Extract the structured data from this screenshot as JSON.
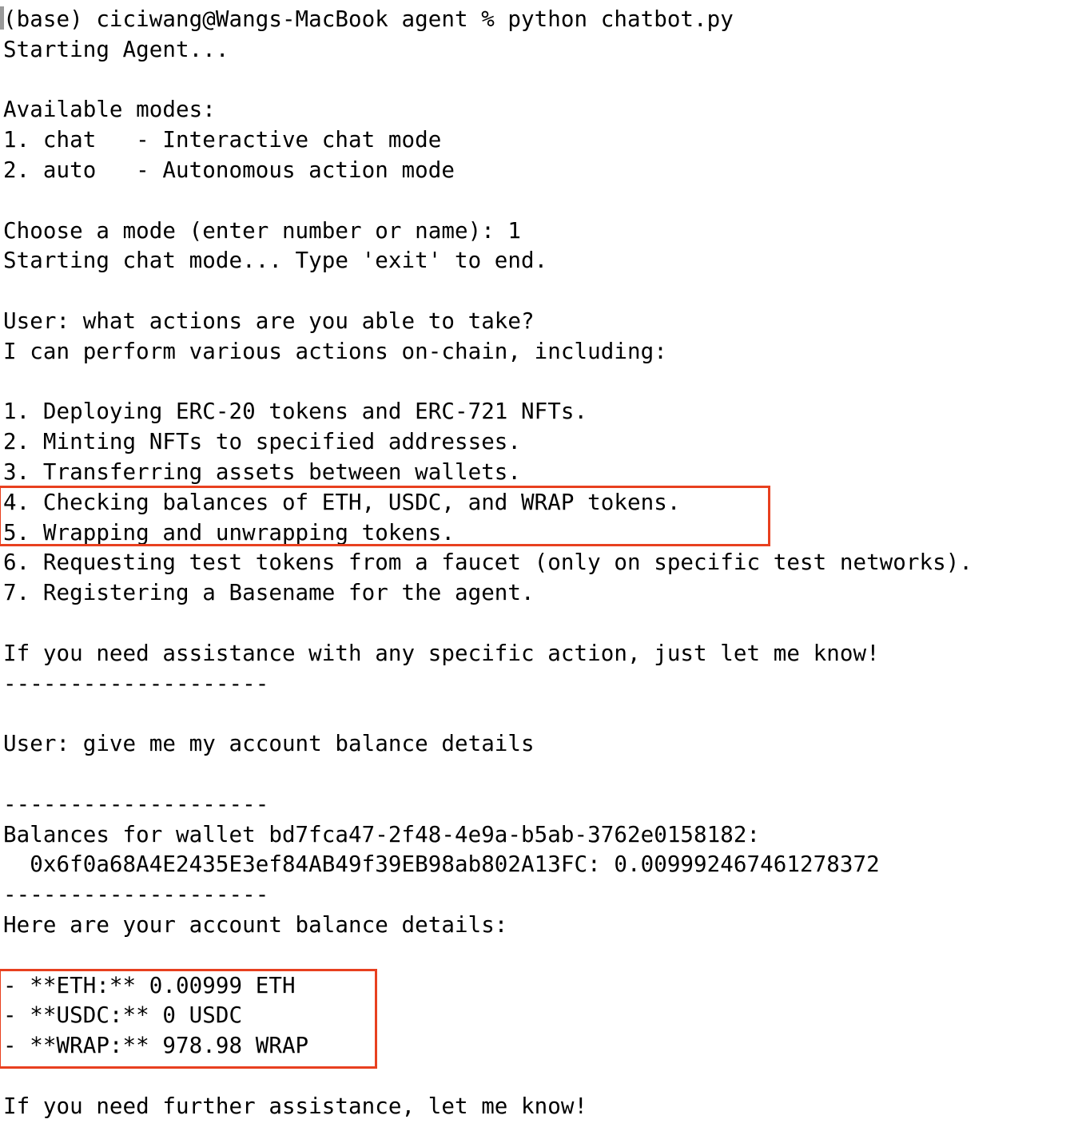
{
  "terminal": {
    "cursor_glyph": "block-cursor",
    "prompt": "(base) ciciwang@Wangs-MacBook agent % python chatbot.py",
    "lines": [
      "(base) ciciwang@Wangs-MacBook agent % python chatbot.py",
      "Starting Agent...",
      "",
      "Available modes:",
      "1. chat   - Interactive chat mode",
      "2. auto   - Autonomous action mode",
      "",
      "Choose a mode (enter number or name): 1",
      "Starting chat mode... Type 'exit' to end.",
      "",
      "User: what actions are you able to take?",
      "I can perform various actions on-chain, including:",
      "",
      "1. Deploying ERC-20 tokens and ERC-721 NFTs.",
      "2. Minting NFTs to specified addresses.",
      "3. Transferring assets between wallets.",
      "4. Checking balances of ETH, USDC, and WRAP tokens.",
      "5. Wrapping and unwrapping tokens.",
      "6. Requesting test tokens from a faucet (only on specific test networks).",
      "7. Registering a Basename for the agent.",
      "",
      "If you need assistance with any specific action, just let me know!",
      "--------------------",
      "",
      "User: give me my account balance details",
      "",
      "--------------------",
      "Balances for wallet bd7fca47-2f48-4e9a-b5ab-3762e0158182:",
      "  0x6f0a68A4E2435E3ef84AB49f39EB98ab802A13FC: 0.009992467461278372",
      "--------------------",
      "Here are your account balance details:",
      "",
      "- **ETH:** 0.00999 ETH",
      "- **USDC:** 0 USDC",
      "- **WRAP:** 978.98 WRAP",
      "",
      "If you need further assistance, let me know!"
    ]
  },
  "session": {
    "shell_env": "(base)",
    "user": "ciciwang",
    "host": "Wangs-MacBook",
    "directory": "agent",
    "command": "python chatbot.py",
    "startup_message": "Starting Agent...",
    "modes_header": "Available modes:",
    "modes": [
      {
        "number": "1.",
        "name": "chat",
        "dash": "-",
        "description": "Interactive chat mode"
      },
      {
        "number": "2.",
        "name": "auto",
        "dash": "-",
        "description": "Autonomous action mode"
      }
    ],
    "mode_prompt": "Choose a mode (enter number or name): 1",
    "mode_selected": "1",
    "mode_started": "Starting chat mode... Type 'exit' to end."
  },
  "conversation": {
    "turn_one": {
      "user_label": "User:",
      "user_message": "what actions are you able to take?",
      "agent_intro": "I can perform various actions on-chain, including:",
      "capabilities": [
        "1. Deploying ERC-20 tokens and ERC-721 NFTs.",
        "2. Minting NFTs to specified addresses.",
        "3. Transferring assets between wallets.",
        "4. Checking balances of ETH, USDC, and WRAP tokens.",
        "5. Wrapping and unwrapping tokens.",
        "6. Requesting test tokens from a faucet (only on specific test networks).",
        "7. Registering a Basename for the agent."
      ],
      "agent_outro": "If you need assistance with any specific action, just let me know!",
      "separator": "--------------------"
    },
    "turn_two": {
      "user_label": "User:",
      "user_message": "give me my account balance details",
      "separator": "--------------------",
      "wallet_header": "Balances for wallet bd7fca47-2f48-4e9a-b5ab-3762e0158182:",
      "wallet_id": "bd7fca47-2f48-4e9a-b5ab-3762e0158182",
      "wallet_address_line": "  0x6f0a68A4E2435E3ef84AB49f39EB98ab802A13FC: 0.009992467461278372",
      "wallet_address": "0x6f0a68A4E2435E3ef84AB49f39EB98ab802A13FC",
      "wallet_raw_balance": "0.009992467461278372",
      "balances_header": "Here are your account balance details:",
      "balances": [
        {
          "line": "- **ETH:** 0.00999 ETH",
          "token": "ETH",
          "amount": "0.00999"
        },
        {
          "line": "- **USDC:** 0 USDC",
          "token": "USDC",
          "amount": "0"
        },
        {
          "line": "- **WRAP:** 978.98 WRAP",
          "token": "WRAP",
          "amount": "978.98"
        }
      ],
      "agent_outro": "If you need further assistance, let me know!"
    }
  },
  "annotations": {
    "color": "#e8401f",
    "boxes": [
      {
        "id": "actions",
        "label": "highlight-capabilities-4-5"
      },
      {
        "id": "balances",
        "label": "highlight-token-balances"
      }
    ]
  }
}
